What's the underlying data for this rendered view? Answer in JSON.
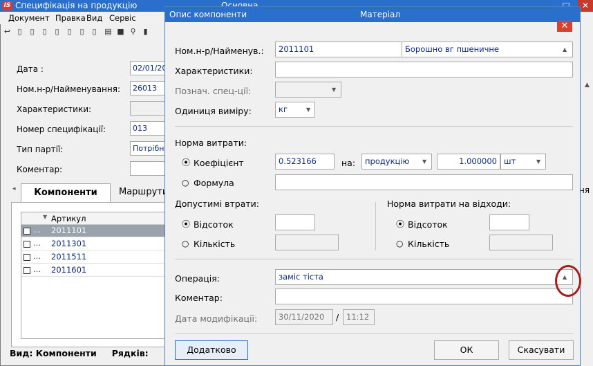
{
  "bg": {
    "title": "Специфікація на продукцію",
    "title_center": "Основна",
    "logo": "IS",
    "menu": [
      "Документ",
      "Правка",
      "Вид",
      "Сервіс"
    ],
    "labels": {
      "date": "Дата :",
      "nom": "Ном.н-р/Найменування:",
      "char": "Характеристики:",
      "specnum": "Номер специфікації:",
      "party": "Тип партії:",
      "comment": "Коментар:"
    },
    "values": {
      "date": "02/01/20",
      "nom": "26013",
      "specnum": "013",
      "party": "Потрібна"
    },
    "tabs": {
      "components": "Компоненти",
      "routes": "Маршрути",
      "right_fragment": "ня"
    },
    "grid_header": "Артикул",
    "rows": [
      {
        "article": "2011101",
        "selected": true
      },
      {
        "article": "2011301",
        "selected": false
      },
      {
        "article": "2011511",
        "selected": false
      },
      {
        "article": "2011601",
        "selected": false
      }
    ],
    "status": {
      "view": "Вид: Компоненти",
      "rows": "Рядків:"
    }
  },
  "dialog": {
    "title": "Опис компоненти",
    "title_center": "Матеріал",
    "nom_label": "Ном.н-р/Найменув.:",
    "nom_code": "2011101",
    "nom_name": "Борошно вг пшеничне",
    "char_label": "Характеристики:",
    "spec_label": "Познач. спец-ції:",
    "unit_label": "Одиниця виміру:",
    "unit_value": "кг",
    "norm_label": "Норма витрати:",
    "coef_label": "Коефіцієнт",
    "coef_value": "0.523166",
    "on_label": "на:",
    "on_value": "продукцію",
    "qty_value": "1.000000",
    "qty_unit": "шт",
    "formula_label": "Формула",
    "losses_label": "Допустимі втрати:",
    "waste_label": "Норма витрати на відходи:",
    "percent_label": "Відсоток",
    "quantity_label": "Кількість",
    "operation_label": "Операція:",
    "operation_value": "заміс тіста",
    "comment_label": "Коментар:",
    "mod_date_label": "Дата модифікації:",
    "mod_date": "30/11/2020",
    "mod_time": "11:12",
    "slash": "/",
    "more_button": "Додатково",
    "ok_button": "ОК",
    "cancel_button": "Скасувати"
  },
  "colors": {
    "titlebar": "#2a6fcb",
    "close": "#d9412f",
    "highlight_circle": "#a81c1c",
    "value_text": "#0b2a8a"
  }
}
